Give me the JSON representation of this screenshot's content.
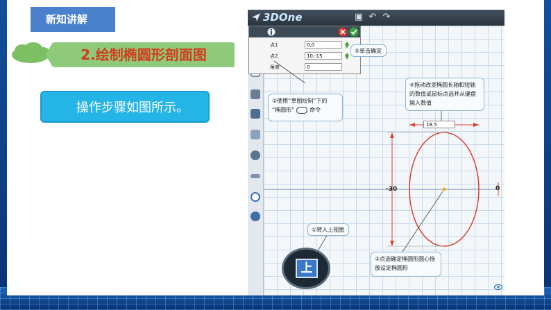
{
  "header": {
    "tag": "新知讲解"
  },
  "section": {
    "title": "2.绘制椭圆形剖面图"
  },
  "instruction": {
    "text": "操作步骤如图所示。"
  },
  "app": {
    "logo": "3DOne",
    "panel": {
      "rows": [
        {
          "label": "点1",
          "value": "0,0"
        },
        {
          "label": "点2",
          "value": "10,-15"
        },
        {
          "label": "角度",
          "value": "0"
        }
      ]
    },
    "callouts": {
      "step5": "⑤单击确定",
      "step2_line1": "②使用“草图绘制”下的",
      "step2_line2": "“椭圆形”",
      "step2_line3": "命令",
      "step4": "④拖动改变椭圆长轴和短轴的数值或鼠标点选并从键盘输入数值",
      "step1": "①转入上视图",
      "step3": "③点选确定椭圆形圆心拖放设定椭圆形"
    },
    "dimension_width": "18.5",
    "dimension_height": "-30",
    "axis_value": "0",
    "view_button": "上",
    "icons": [
      "info-icon",
      "close-icon",
      "check-icon",
      "save-icon",
      "undo-icon",
      "redo-icon",
      "pin-icon"
    ]
  },
  "colors": {
    "accent": "#25b4e6",
    "title": "#d23b1c",
    "title_bg": "#8fc97a",
    "tag_bg": "#4a80cc",
    "ellipse": "#d84030"
  }
}
